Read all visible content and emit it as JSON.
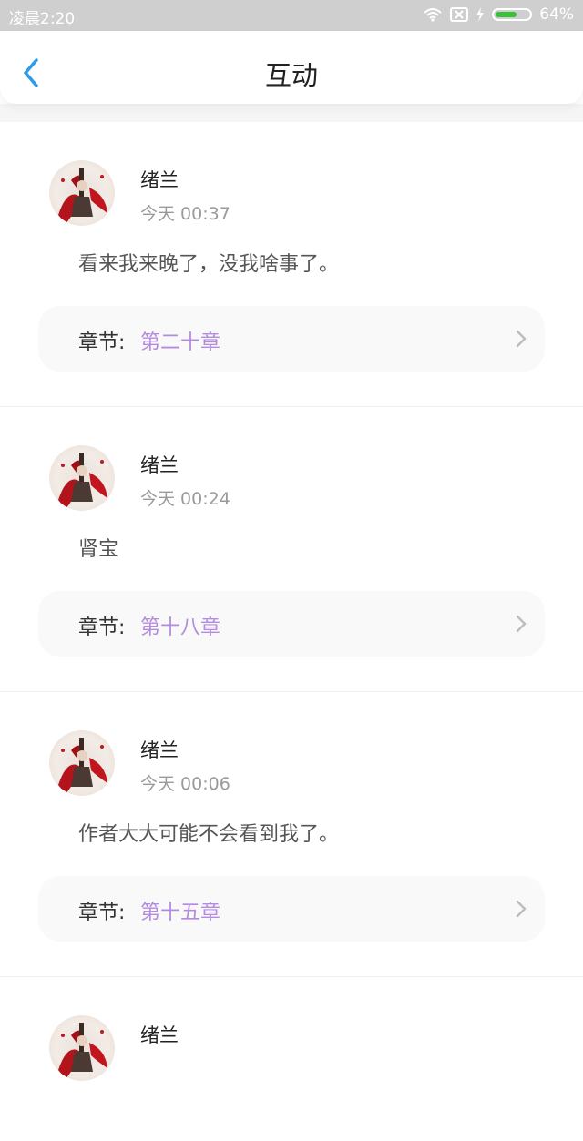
{
  "status_bar": {
    "time": "凌晨2:20",
    "battery": "64%",
    "battery_level": 0.64,
    "icons": [
      "wifi-icon",
      "sim-card-icon",
      "charging-icon",
      "battery-icon"
    ]
  },
  "header": {
    "title": "互动",
    "back_icon": "chevron-left-icon",
    "accent_color": "#2f9be8"
  },
  "chapter_prefix": "章节:",
  "link_color": "#b48be0",
  "comments": [
    {
      "user": "绪兰",
      "time": "今天 00:37",
      "text": "看来我来晚了，没我啥事了。",
      "chapter": "第二十章"
    },
    {
      "user": "绪兰",
      "time": "今天 00:24",
      "text": "肾宝",
      "chapter": "第十八章"
    },
    {
      "user": "绪兰",
      "time": "今天 00:06",
      "text": "作者大大可能不会看到我了。",
      "chapter": "第十五章"
    },
    {
      "user": "绪兰"
    }
  ]
}
